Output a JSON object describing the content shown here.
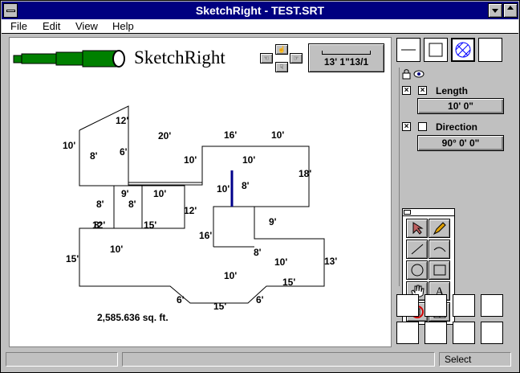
{
  "app": {
    "title": "SketchRight - TEST.SRT",
    "brand": "SketchRight"
  },
  "menu": [
    "File",
    "Edit",
    "View",
    "Help"
  ],
  "coord": {
    "readout": "13' 1\"13/1"
  },
  "plan": {
    "area": "2,585.636 sq. ft.",
    "labels": [
      "12'",
      "10'",
      "8'",
      "6'",
      "20'",
      "16'",
      "10'",
      "10'",
      "10'",
      "18'",
      "10'",
      "8'",
      "9'",
      "8'",
      "10'",
      "8'",
      "8'",
      "12'",
      "12'",
      "15'",
      "16'",
      "9'",
      "15'",
      "10'",
      "8'",
      "10'",
      "13'",
      "10'",
      "15'",
      "6'",
      "15'",
      "6'"
    ]
  },
  "properties": {
    "length": {
      "label": "Length",
      "value": "10' 0\"",
      "checked_x": true,
      "checked": true
    },
    "direction": {
      "label": "Direction",
      "value": "90° 0' 0\"",
      "checked_x": true,
      "checked": false
    }
  },
  "status": {
    "mode": "Select"
  },
  "colors": {
    "titlebar": "#000080",
    "accent_line": "#00008b",
    "scope": "#008000",
    "hatch": "#0000ff"
  }
}
